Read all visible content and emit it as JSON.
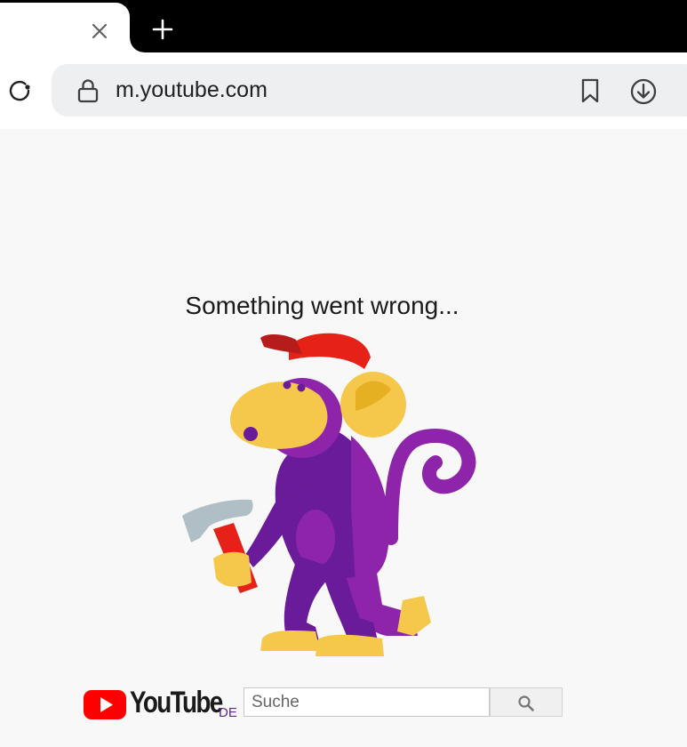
{
  "browser": {
    "tab": {
      "close_icon": "close-icon"
    },
    "new_tab_icon": "plus-icon",
    "reload_icon": "reload-icon",
    "address_bar": {
      "url": "m.youtube.com",
      "lock_icon": "lock-icon"
    },
    "bookmark_icon": "bookmark-icon",
    "download_icon": "download-icon"
  },
  "page": {
    "error_title": "Something went wrong...",
    "illustration": "monkey-with-hammer",
    "footer": {
      "logo_text": "YouTube",
      "region": "DE",
      "search_placeholder": "Suche",
      "search_icon": "search-icon"
    }
  },
  "colors": {
    "youtube_red": "#ff0000",
    "monkey_purple": "#6a1b9a",
    "monkey_face": "#f5c84c",
    "cap_red": "#e62117",
    "region_purple": "#5b2a8a"
  }
}
